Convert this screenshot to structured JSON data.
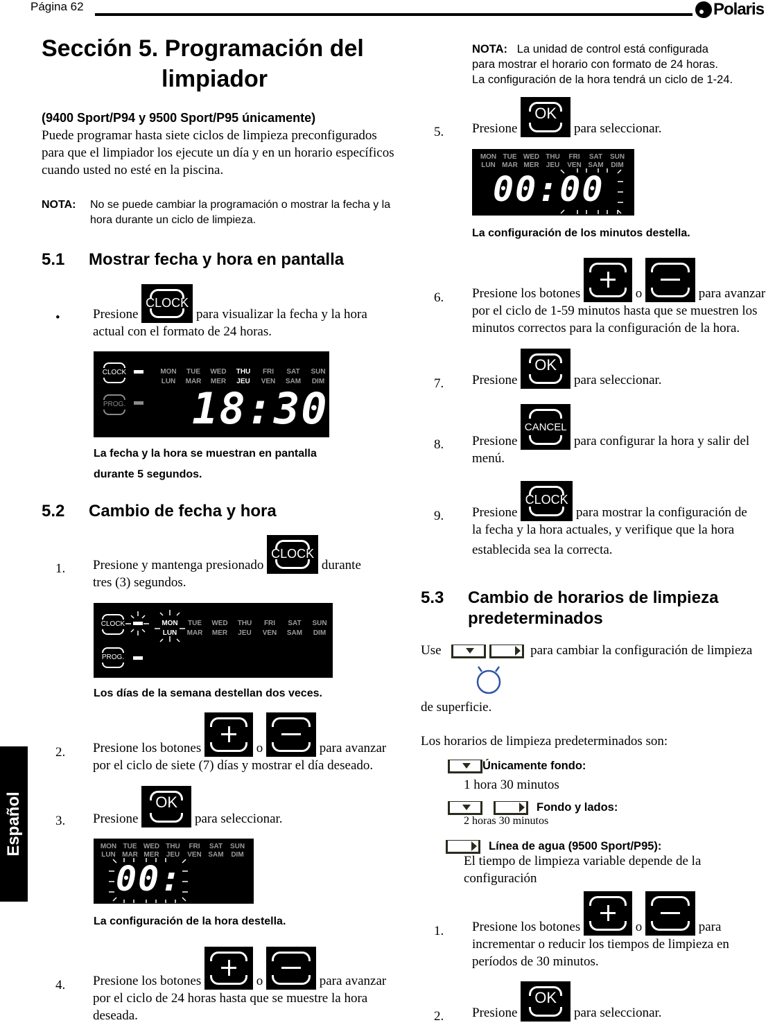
{
  "header": {
    "page_label": "Página 62",
    "brand": "Polaris"
  },
  "side_tab": "Español",
  "title": {
    "line1": "Sección 5. Programación del",
    "line2": "limpiador"
  },
  "models_subhead": "(9400 Sport/P94 y 9500 Sport/P95 únicamente)",
  "intro": "Puede programar hasta siete ciclos de limpieza preconfigurados para que el limpiador los ejecute un día y en un horario específicos cuando usted no esté en la piscina.",
  "note1": {
    "label": "NOTA:",
    "text": "No se puede cambiar la programación o mostrar la fecha y la hora durante un ciclo de limpieza."
  },
  "buttons": {
    "clock": "CLOCK",
    "ok": "OK",
    "cancel": "CANCEL",
    "prog": "PROG."
  },
  "days_en": [
    "MON",
    "TUE",
    "WED",
    "THU",
    "FRI",
    "SAT",
    "SUN"
  ],
  "days_fr": [
    "LUN",
    "MAR",
    "MER",
    "JEU",
    "VEN",
    "SAM",
    "DIM"
  ],
  "sec51": {
    "num": "5.1",
    "title": "Mostrar fecha y hora en pantalla",
    "bullet": "•",
    "pre": "Presione",
    "post": "para visualizar la fecha y la hora",
    "cont": "actual con el formato de 24 horas.",
    "display_time": "18:30",
    "active_day": "THU",
    "caption_l1": "La fecha y la hora se muestran en pantalla",
    "caption_l2": "durante 5 segundos."
  },
  "sec52": {
    "num": "5.2",
    "title": "Cambio de fecha y hora",
    "step1": {
      "n": "1.",
      "pre": "Presione y mantenga presionado",
      "post": "durante",
      "cont": "tres (3) segundos."
    },
    "caption1": "Los días de la semana destellan dos veces.",
    "step2": {
      "n": "2.",
      "pre": "Presione los botones",
      "or": "o",
      "post": "para avanzar",
      "cont": "por el ciclo de siete (7) días y mostrar el día deseado."
    },
    "step3": {
      "n": "3.",
      "pre": "Presione",
      "post": "para seleccionar."
    },
    "display_hours": "00:",
    "caption3": "La configuración de la hora destella.",
    "step4": {
      "n": "4.",
      "pre": "Presione los botones",
      "or": "o",
      "post": "para avanzar",
      "cont1": "por el ciclo de 24 horas hasta que se muestre la hora",
      "cont2": "deseada."
    }
  },
  "right": {
    "note2": {
      "label": "NOTA:",
      "l1": "La unidad de control está configurada",
      "l2": "para mostrar el horario con formato de 24 horas.",
      "l3": "La configuración de la hora tendrá un ciclo de 1-24."
    },
    "step5": {
      "n": "5.",
      "pre": "Presione",
      "post": "para seleccionar."
    },
    "display_minutes": "00:00",
    "caption5": "La configuración de los minutos destella.",
    "step6": {
      "n": "6.",
      "pre": "Presione los botones",
      "or": "o",
      "post": "para avanzar",
      "cont1": "por el ciclo de 1-59 minutos hasta que se muestren los",
      "cont2": "minutos correctos para la configuración de la hora."
    },
    "step7": {
      "n": "7.",
      "pre": "Presione",
      "post": "para seleccionar."
    },
    "step8": {
      "n": "8.",
      "pre": "Presione",
      "post": "para configurar la hora y salir del",
      "cont": "menú."
    },
    "step9": {
      "n": "9.",
      "pre": "Presione",
      "post": "para mostrar la configuración de",
      "cont1": "la fecha y la hora actuales, y verifique que la hora",
      "cont2": "establecida sea la correcta."
    }
  },
  "sec53": {
    "num": "5.3",
    "title_l1": "Cambio de horarios de limpieza",
    "title_l2": "predeterminados",
    "use_pre": "Use",
    "use_post": "para cambiar la configuración de limpieza",
    "use_cont": "de superficie.",
    "defaults_intro": "Los horarios de limpieza predeterminados son:",
    "modes": [
      {
        "label": "Únicamente fondo:",
        "time": "1 hora 30 minutos"
      },
      {
        "label": "Fondo y lados:",
        "time": "2 horas 30 minutos"
      },
      {
        "label": "Línea de agua (9500 Sport/P95):",
        "time_l1": "El tiempo de limpieza variable depende de la",
        "time_l2": "configuración"
      }
    ],
    "step1": {
      "n": "1.",
      "pre": "Presione los botones",
      "or": "o",
      "post": "para",
      "cont1": "incrementar o reducir los tiempos de limpieza en",
      "cont2": "períodos de 30 minutos."
    },
    "step2": {
      "n": "2.",
      "pre": "Presione",
      "post": "para seleccionar."
    }
  },
  "colors": {
    "surface_icon": "#2f55a4",
    "icon_ink": "#2b2a1f"
  }
}
